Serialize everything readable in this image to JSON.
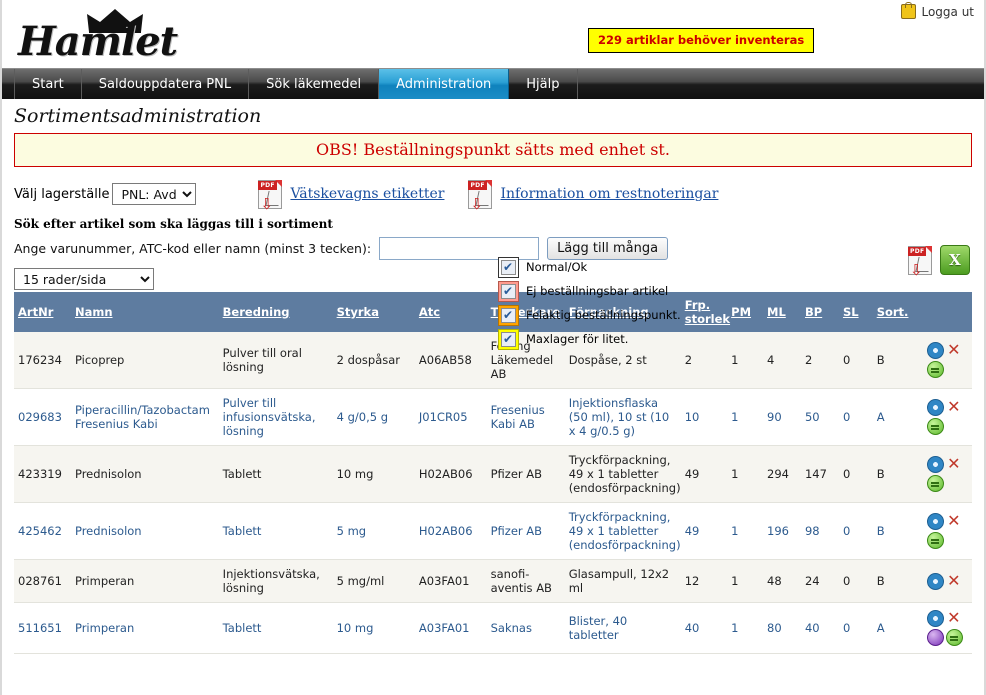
{
  "brand": {
    "name": "Hamlet",
    "crown_icon": "crown-icon"
  },
  "header": {
    "alert_text": "229 artiklar behöver inventeras",
    "logout_label": "Logga ut",
    "lock_icon": "lock-icon"
  },
  "nav": {
    "items": [
      {
        "label": "Start",
        "active": false
      },
      {
        "label": "Saldouppdatera PNL",
        "active": false
      },
      {
        "label": "Sök läkemedel",
        "active": false
      },
      {
        "label": "Administration",
        "active": true
      },
      {
        "label": "Hjälp",
        "active": false
      }
    ]
  },
  "page": {
    "title": "Sortimentsadministration",
    "obs_text": "OBS! Beställningspunkt sätts med enhet st."
  },
  "lagerstalle": {
    "label": "Välj lagerställe",
    "selected": "PNL: Avd",
    "options": [
      "PNL: Avd"
    ]
  },
  "pdf_links": [
    {
      "label": "Vätskevagns etiketter",
      "icon": "pdf-icon"
    },
    {
      "label": "Information om restnoteringar",
      "icon": "pdf-icon"
    }
  ],
  "search": {
    "section_title": "Sök efter artikel som ska läggas till i sortiment",
    "field_label": "Ange varunummer, ATC-kod eller namn (minst 3 tecken):",
    "value": "",
    "placeholder": "",
    "button_label": "Lägg till många"
  },
  "legend": [
    {
      "label": "Normal/Ok",
      "color": "#ffffff",
      "checked": true
    },
    {
      "label": "Ej beställningsbar artikel",
      "color": "#ff9b8f",
      "checked": true
    },
    {
      "label": "Felaktig beställningspunkt.",
      "color": "#ffa500",
      "checked": true
    },
    {
      "label": "Maxlager för litet.",
      "color": "#ffff00",
      "checked": true
    }
  ],
  "exports": [
    {
      "icon": "pdf-export-icon",
      "label": "PDF"
    },
    {
      "icon": "excel-export-icon",
      "label": "X"
    }
  ],
  "per_page": {
    "selected": "15 rader/sida",
    "options": [
      "15 rader/sida"
    ]
  },
  "table": {
    "columns": [
      "ArtNr",
      "Namn",
      "Beredning",
      "Styrka",
      "Atc",
      "Tillverkare",
      "Förpackning",
      "Frp. storlek",
      "PM",
      "ML",
      "BP",
      "SL",
      "Sort."
    ],
    "rows": [
      {
        "artnr": "176234",
        "namn": "Picoprep",
        "beredning": "Pulver till oral lösning",
        "styrka": "2 dospåsar",
        "atc": "A06AB58",
        "tillverkare": "Ferring Läkemedel AB",
        "forpackning": "Dospåse, 2 st",
        "frp": "2",
        "pm": "1",
        "ml": "4",
        "bp": "2",
        "sl": "0",
        "sort": "B",
        "style": "alt",
        "link": false,
        "icons": [
          "gear-icon",
          "delete-icon",
          "green-status-icon"
        ]
      },
      {
        "artnr": "029683",
        "namn": "Piperacillin/Tazobactam Fresenius Kabi",
        "beredning": "Pulver till infusionsvätska, lösning",
        "styrka": "4 g/0,5 g",
        "atc": "J01CR05",
        "tillverkare": "Fresenius Kabi AB",
        "forpackning": "Injektionsflaska (50 ml), 10 st (10 x 4 g/0.5 g)",
        "frp": "10",
        "pm": "1",
        "ml": "90",
        "bp": "50",
        "sl": "0",
        "sort": "A",
        "style": "norm",
        "link": true,
        "icons": [
          "gear-icon",
          "delete-icon",
          "green-status-icon"
        ]
      },
      {
        "artnr": "423319",
        "namn": "Prednisolon",
        "beredning": "Tablett",
        "styrka": "10 mg",
        "atc": "H02AB06",
        "tillverkare": "Pfizer AB",
        "forpackning": "Tryckförpackning, 49 x 1 tabletter (endosförpackning)",
        "frp": "49",
        "pm": "1",
        "ml": "294",
        "bp": "147",
        "sl": "0",
        "sort": "B",
        "style": "alt",
        "link": false,
        "icons": [
          "gear-icon",
          "delete-icon",
          "green-status-icon"
        ]
      },
      {
        "artnr": "425462",
        "namn": "Prednisolon",
        "beredning": "Tablett",
        "styrka": "5 mg",
        "atc": "H02AB06",
        "tillverkare": "Pfizer AB",
        "forpackning": "Tryckförpackning, 49 x 1 tabletter (endosförpackning)",
        "frp": "49",
        "pm": "1",
        "ml": "196",
        "bp": "98",
        "sl": "0",
        "sort": "B",
        "style": "norm",
        "link": true,
        "icons": [
          "gear-icon",
          "delete-icon",
          "green-status-icon"
        ]
      },
      {
        "artnr": "028761",
        "namn": "Primperan",
        "beredning": "Injektionsvätska, lösning",
        "styrka": "5 mg/ml",
        "atc": "A03FA01",
        "tillverkare": "sanofi-aventis AB",
        "forpackning": "Glasampull, 12x2 ml",
        "frp": "12",
        "pm": "1",
        "ml": "48",
        "bp": "24",
        "sl": "0",
        "sort": "B",
        "style": "alt",
        "link": false,
        "icons": [
          "gear-icon",
          "delete-icon"
        ]
      },
      {
        "artnr": "511651",
        "namn": "Primperan",
        "beredning": "Tablett",
        "styrka": "10 mg",
        "atc": "A03FA01",
        "tillverkare": "Saknas",
        "forpackning": "Blister, 40 tabletter",
        "frp": "40",
        "pm": "1",
        "ml": "80",
        "bp": "40",
        "sl": "0",
        "sort": "A",
        "style": "norm",
        "link": true,
        "icons": [
          "gear-icon",
          "delete-icon",
          "purple-status-icon",
          "green-status-icon"
        ]
      }
    ]
  },
  "colors": {
    "nav_active": "#1b8dc6",
    "table_header": "#5e7ca0",
    "alert_bg": "#ffff00",
    "alert_text": "#cc0000",
    "obs_bg": "#fcfce0",
    "link": "#2c5a8e"
  }
}
